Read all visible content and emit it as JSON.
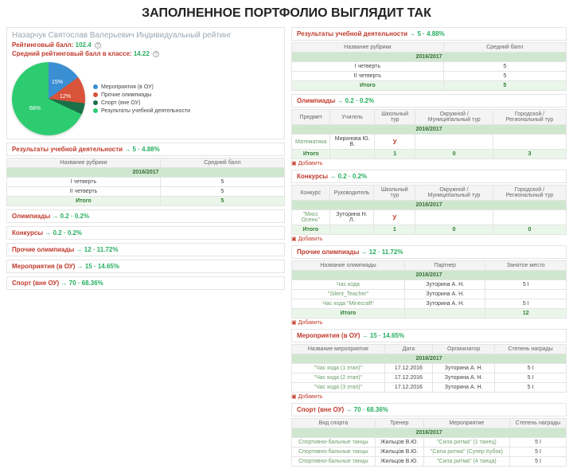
{
  "title": "ЗАПОЛНЕННОЕ ПОРТФОЛИО ВЫГЛЯДИТ  ТАК",
  "student": {
    "name": "Назарчук Святослав Валерьевич",
    "subtitle": "Индивидуальный рейтинг",
    "rating_label": "Рейтинговый балл:",
    "rating_value": "102.4",
    "avg_label": "Средний рейтинговый балл в классе:",
    "avg_value": "14.22",
    "q": "?"
  },
  "pie": {
    "p1": "15%",
    "p2": "12%",
    "p3": "68%"
  },
  "legend": {
    "a": "Мероприятия (в ОУ)",
    "b": "Прочие олимпиады",
    "c": "Спорт (вне ОУ)",
    "d": "Результаты учебной деятельности"
  },
  "year": "2016/2017",
  "cols": {
    "category": "Название рубрики",
    "avg": "Средний балл",
    "subject": "Предмет",
    "teacher": "Учитель",
    "school_tour": "Школьный тур",
    "district": "Окружной / Муниципальный тур",
    "city": "Городской / Региональный тур",
    "contest": "Конкурс",
    "leader": "Руководитель",
    "olymp_name": "Название олимпиады",
    "partner": "Партнер",
    "seat": "Занятое место",
    "event": "Название мероприятия",
    "date": "Дата",
    "org": "Организатор",
    "award": "Степень награды",
    "sport": "Вид спорта",
    "coach": "Тренер",
    "event2": "Мероприятие",
    "award2": "Степень награды"
  },
  "sections": {
    "study": "Результаты учебной деятельности",
    "olymp": "Олимпиады",
    "contests": "Конкурсы",
    "other_olymp": "Прочие олимпиады",
    "events": "Мероприятия (в ОУ)",
    "sport": "Спорт (вне ОУ)"
  },
  "counts": {
    "study": "→ 5 · 4.88%",
    "olymp": "→ 0.2 · 0.2%",
    "contests": "→ 0.2 · 0.2%",
    "other_olymp": "→ 12 · 11.72%",
    "events": "→ 15 · 14.65%",
    "sport": "→ 70 · 68.36%"
  },
  "study_rows": {
    "r1": {
      "a": "I четверть",
      "b": "5"
    },
    "r2": {
      "a": "II четверть",
      "b": "5"
    },
    "total": {
      "a": "Итого",
      "b": "5"
    }
  },
  "olymp_rows": {
    "r1": {
      "a": "Математика",
      "b": "Миронова Ю. В.",
      "c": "У",
      "d": "",
      "e": ""
    },
    "total": {
      "a": "Итого",
      "b": "",
      "c": "1",
      "d": "0",
      "e": "3"
    }
  },
  "contest_rows": {
    "r1": {
      "a": "\"Мисс Осень\"",
      "b": "Зуторина Н. Л.",
      "c": "У",
      "d": "",
      "e": ""
    },
    "total": {
      "a": "Итого",
      "b": "",
      "c": "1",
      "d": "0",
      "e": "0"
    }
  },
  "other_rows": {
    "r1": {
      "a": "Час кода",
      "b": "Зуторина А. Н.",
      "c": "5 I"
    },
    "r2": {
      "a": "\"Silent_Teacher\"",
      "b": "Зуторина А. Н.",
      "c": ""
    },
    "r3": {
      "a": "Час кода \"Minecraft\"",
      "b": "Зуторина А. Н.",
      "c": "5 I"
    },
    "total": {
      "a": "Итого",
      "b": "",
      "c": "12"
    }
  },
  "event_rows": {
    "r1": {
      "a": "\"Час кода (1 этап)\"",
      "b": "17.12.2016",
      "c": "Зуторина А. Н.",
      "d": "5 I"
    },
    "r2": {
      "a": "\"Час кода (2 этап)\"",
      "b": "17.12.2016",
      "c": "Зуторина А. Н.",
      "d": "5 I"
    },
    "r3": {
      "a": "\"Час кода (3 этап)\"",
      "b": "17.12.2016",
      "c": "Зуторина А. Н.",
      "d": "5 I"
    }
  },
  "sport_rows": {
    "r1": {
      "a": "Спортивно-бальные танцы",
      "b": "Жильцов В.Ю.",
      "c": "\"Сила ритма\" (1 танец)",
      "d": "5 I"
    },
    "r2": {
      "a": "Спортивно-бальные танцы",
      "b": "Жильцов В.Ю.",
      "c": "\"Сила ритма\" (Супер Кубок)",
      "d": "5 I"
    },
    "r3": {
      "a": "Спортивно-бальные танцы",
      "b": "Жильцов В.Ю.",
      "c": "\"Сила ритма\" (4 танца)",
      "d": "5 I"
    }
  },
  "add": "Добавить",
  "right_counts": {
    "study": "→ 5 · 4.88%",
    "olymp": "→ 0.2 · 0.2%",
    "contests": "→ 0.2 · 0.2%",
    "other_olymp": "→ 12 · 11.72%",
    "events": "→ 15 · 14.65%",
    "sport": "→ 70 · 68.36%"
  },
  "chart_data": {
    "type": "pie",
    "title": "Индивидуальный рейтинг",
    "series": [
      {
        "name": "Мероприятия (в ОУ)",
        "value": 15,
        "color": "#3a8fd3"
      },
      {
        "name": "Прочие олимпиады",
        "value": 12,
        "color": "#d9523a"
      },
      {
        "name": "Спорт (вне ОУ)",
        "value": 5,
        "color": "#1a7048"
      },
      {
        "name": "Результаты учебной деятельности",
        "value": 68,
        "color": "#2ecc71"
      }
    ]
  }
}
